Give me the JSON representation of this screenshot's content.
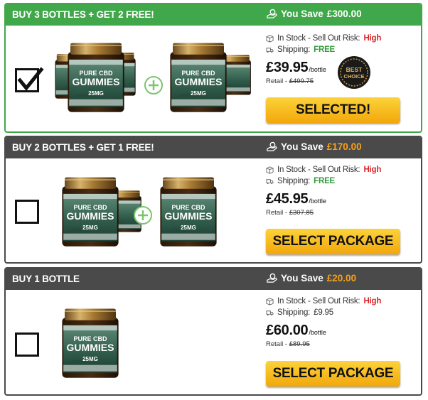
{
  "packages": [
    {
      "title": "BUY 3 BOTTLES + GET 2 FREE!",
      "save_label": "You Save",
      "save_amount": "£300.00",
      "stock_label": "In Stock - Sell Out Risk:",
      "risk": "High",
      "shipping_label": "Shipping:",
      "shipping_value": "FREE",
      "price": "£39.95",
      "per": "/bottle",
      "retail_label": "Retail - ",
      "retail_value": "£499.75",
      "button": "SELECTED!",
      "checked": true,
      "badge_line1": "BEST",
      "badge_line2": "CHOICE"
    },
    {
      "title": "BUY 2 BOTTLES + GET 1 FREE!",
      "save_label": "You Save",
      "save_amount": "£170.00",
      "stock_label": "In Stock - Sell Out Risk:",
      "risk": "High",
      "shipping_label": "Shipping:",
      "shipping_value": "FREE",
      "price": "£45.95",
      "per": "/bottle",
      "retail_label": "Retail - ",
      "retail_value": "£307.85",
      "button": "SELECT PACKAGE",
      "checked": false
    },
    {
      "title": "BUY 1 BOTTLE",
      "save_label": "You Save",
      "save_amount": "£20.00",
      "stock_label": "In Stock - Sell Out Risk:",
      "risk": "High",
      "shipping_label": "Shipping:",
      "shipping_value": "£9.95",
      "price": "£60.00",
      "per": "/bottle",
      "retail_label": "Retail - ",
      "retail_value": "£89.95",
      "button": "SELECT PACKAGE",
      "checked": false
    }
  ],
  "jar": {
    "line1": "PURE CBD",
    "line2": "GUMMIES",
    "dose": "25MG"
  },
  "icons": {
    "save": "hand-coin-icon",
    "stock": "box-icon",
    "shipping": "truck-icon",
    "plus": "plus-circle-icon",
    "check": "checkmark-icon"
  },
  "colors": {
    "green": "#40a84a",
    "dark": "#4a4a4a",
    "orange": "#f7a21b",
    "risk": "#d8252a",
    "button": "#f2a70b"
  }
}
